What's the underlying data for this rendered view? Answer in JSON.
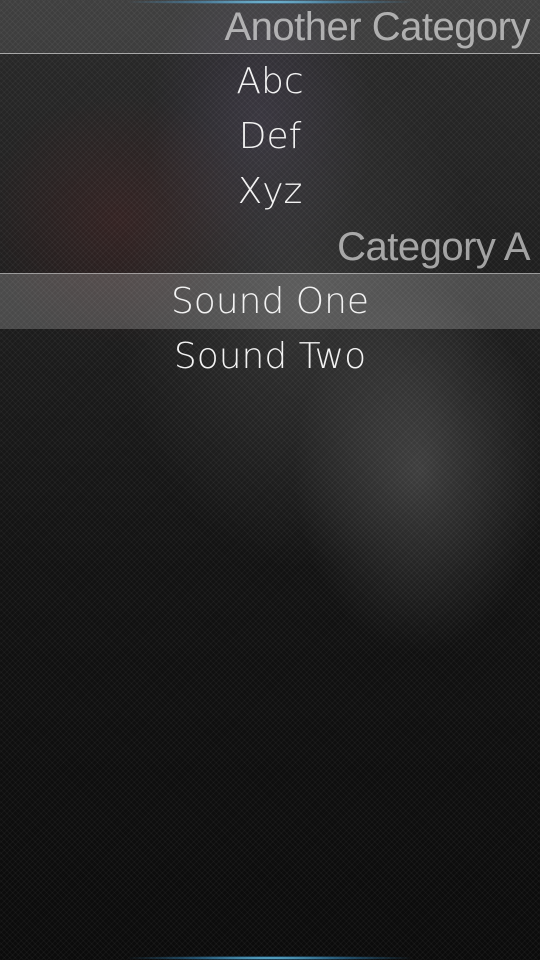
{
  "categories": [
    {
      "title": "Another Category",
      "items": [
        "Abc",
        "Def",
        "Xyz"
      ]
    },
    {
      "title": "Category A",
      "items": [
        "Sound One",
        "Sound Two"
      ],
      "selected_item": "Sound One"
    }
  ],
  "colors": {
    "glow_accent": "#78dcff",
    "selection_highlight": "#5a5a5a"
  }
}
